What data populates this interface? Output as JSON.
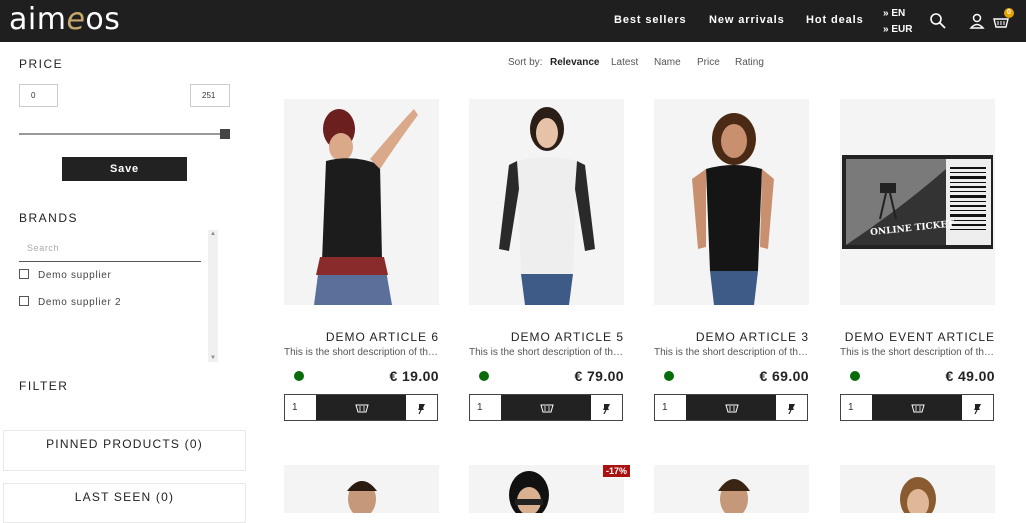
{
  "header": {
    "logo_main": "aim",
    "logo_e": "e",
    "logo_tail": "os",
    "nav": [
      "Best sellers",
      "New arrivals",
      "Hot deals"
    ],
    "language": "» EN",
    "currency": "» EUR",
    "cart_count": "0"
  },
  "sidebar": {
    "price_title": "PRICE",
    "price_min": "0",
    "price_max": "251",
    "save_label": "Save",
    "brands_title": "BRANDS",
    "brand_search_placeholder": "Search",
    "brands": [
      "Demo supplier",
      "Demo supplier 2"
    ],
    "filter_title": "FILTER",
    "pinned_label": "PINNED PRODUCTS (0)",
    "last_seen_label": "LAST SEEN (0)"
  },
  "sort": {
    "label": "Sort by:",
    "options": [
      "Relevance",
      "Latest",
      "Name",
      "Price",
      "Rating"
    ],
    "active": "Relevance"
  },
  "products": [
    {
      "name": "DEMO ARTICLE 6",
      "desc": "This is the short description of the d...",
      "price": "€ 19.00",
      "qty": "1",
      "stock_color": "#0a6b0a"
    },
    {
      "name": "DEMO ARTICLE 5",
      "desc": "This is the short description of the d...",
      "price": "€ 79.00",
      "qty": "1",
      "stock_color": "#0a6b0a"
    },
    {
      "name": "DEMO ARTICLE 3",
      "desc": "This is the short description of the d...",
      "price": "€ 69.00",
      "qty": "1",
      "stock_color": "#0a6b0a"
    },
    {
      "name": "DEMO EVENT ARTICLE",
      "desc": "This is the short description of the e...",
      "price": "€ 49.00",
      "qty": "1",
      "stock_color": "#0a6b0a"
    }
  ],
  "row2_sale_badge": "-17%",
  "ticket_text": "ONLINE TICKET",
  "colors": {
    "header_bg": "#1f1f1f",
    "accent": "#c4a96a",
    "badge": "#e8a400",
    "stock": "#0a6b0a",
    "sale": "#aa1111"
  }
}
